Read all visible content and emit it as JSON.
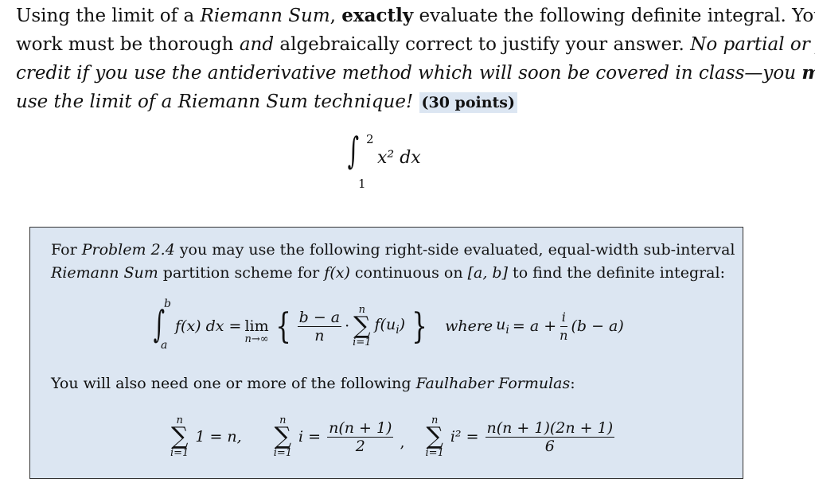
{
  "problem": {
    "l1": [
      "Using the limit of a ",
      "Riemann Sum",
      ", ",
      "exactly",
      " evaluate the following definite integral.  Your"
    ],
    "l2": [
      "work must be thorough ",
      "and",
      " algebraically correct to justify your answer.  ",
      "No partial or full"
    ],
    "l3": [
      "credit if you use the antiderivative method which will soon be covered in class—you ",
      "must"
    ],
    "l4": [
      "use the limit of a Riemann Sum technique!",
      "(30 points)"
    ],
    "integral": {
      "lower": "1",
      "upper": "2",
      "integrand": "x² dx"
    }
  },
  "box": {
    "p1": [
      "For ",
      "Problem 2.4",
      " you may use the following right-side evaluated, equal-width sub-interval"
    ],
    "p2": [
      "Riemann Sum",
      " partition scheme for ",
      "f(x)",
      " continuous on ",
      "[a, b]",
      " to find the definite integral:"
    ],
    "formula": {
      "lower": "a",
      "upper": "b",
      "integrand": "f(x) dx =",
      "lim": "lim",
      "lim_sub": "n→∞",
      "frac_num": "b − a",
      "frac_den": "n",
      "dot": "·",
      "sum_top": "n",
      "sum_bot": "i=1",
      "term": "f(u",
      "term_sub": "i",
      "term_end": ")",
      "where": "where",
      "u": "u",
      "u_sub": "i",
      "eq": "= a +",
      "f2_num": "i",
      "f2_den": "n",
      "tail": "(b − a)"
    },
    "p3": [
      "You will also need one or more of the following ",
      "Faulhaber Formulas",
      ":"
    ],
    "faulhaber": [
      {
        "top": "n",
        "bot": "i=1",
        "body": "1 = n,"
      },
      {
        "top": "n",
        "bot": "i=1",
        "body": "i =",
        "num": "n(n + 1)",
        "den": "2",
        "after": ","
      },
      {
        "top": "n",
        "bot": "i=1",
        "body": "i² =",
        "num": "n(n + 1)(2n + 1)",
        "den": "6"
      }
    ]
  },
  "colors": {
    "highlight": "#dce6f2",
    "box_bg": "#dce6f2",
    "box_border": "#333333"
  }
}
